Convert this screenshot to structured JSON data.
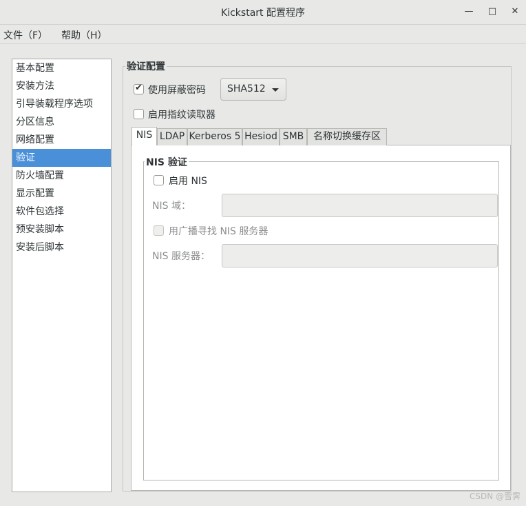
{
  "window": {
    "title": "Kickstart 配置程序",
    "minimize_glyph": "—",
    "maximize_glyph": "□",
    "close_glyph": "✕"
  },
  "menubar": {
    "file": "文件（F）",
    "help": "帮助（H）"
  },
  "sidebar": {
    "items": [
      {
        "label": "基本配置",
        "selected": false
      },
      {
        "label": "安装方法",
        "selected": false
      },
      {
        "label": "引导装载程序选项",
        "selected": false
      },
      {
        "label": "分区信息",
        "selected": false
      },
      {
        "label": "网络配置",
        "selected": false
      },
      {
        "label": "验证",
        "selected": true
      },
      {
        "label": "防火墙配置",
        "selected": false
      },
      {
        "label": "显示配置",
        "selected": false
      },
      {
        "label": "软件包选择",
        "selected": false
      },
      {
        "label": "预安装脚本",
        "selected": false
      },
      {
        "label": "安装后脚本",
        "selected": false
      }
    ]
  },
  "auth": {
    "section_title": "验证配置",
    "shadow_password": {
      "label": "使用屏蔽密码",
      "checked": true
    },
    "hash_select": {
      "value": "SHA512"
    },
    "fingerprint": {
      "label": "启用指纹读取器",
      "checked": false
    },
    "tabs": [
      {
        "label": "NIS",
        "active": true
      },
      {
        "label": "LDAP",
        "active": false
      },
      {
        "label": "Kerberos 5",
        "active": false
      },
      {
        "label": "Hesiod",
        "active": false
      },
      {
        "label": "SMB",
        "active": false
      },
      {
        "label": "名称切换缓存区",
        "active": false
      }
    ],
    "nis": {
      "frame_title": "NIS 验证",
      "enable": {
        "label": "启用  NIS",
        "checked": false
      },
      "domain_label": "NIS 域：",
      "domain_value": "",
      "broadcast": {
        "label": "用广播寻找  NIS 服务器",
        "checked": false
      },
      "server_label": "NIS 服务器：",
      "server_value": ""
    }
  },
  "watermark": "CSDN @雪霁"
}
